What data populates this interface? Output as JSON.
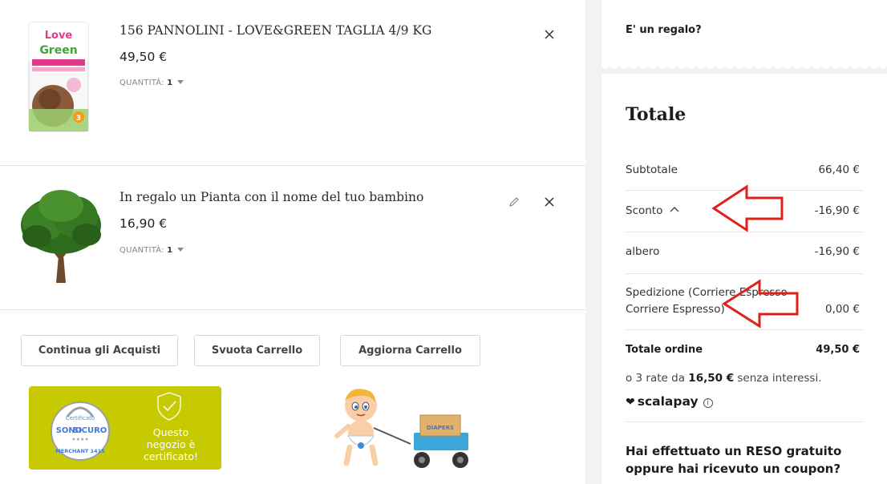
{
  "cart": {
    "items": [
      {
        "title": "156 PANNOLINI - LOVE&GREEN TAGLIA 4/9 KG",
        "price": "49,50 €",
        "qty_label": "QUANTITÀ:",
        "qty_value": "1",
        "image_icon": "diaper-package-image"
      },
      {
        "title": "In regalo un Pianta con il nome del tuo bambino",
        "price": "16,90 €",
        "qty_label": "QUANTITÀ:",
        "qty_value": "1",
        "image_icon": "tree-image"
      }
    ],
    "buttons": {
      "continue": "Continua gli Acquisti",
      "empty": "Svuota Carrello",
      "update": "Aggiorna Carrello"
    },
    "certificate": {
      "text_line1": "Questo",
      "text_line2": "negozio è",
      "text_line3": "certificato!",
      "seal_top": "Certificato",
      "seal_brand_1": "SONO",
      "seal_brand_2": "SICURO",
      "seal_bottom": "MERCHANT 1415",
      "color": "#c7ca00"
    },
    "mascot_label": "DIAPERS"
  },
  "sidebar": {
    "gift_label": "E' un regalo?",
    "totals_title": "Totale",
    "rows": {
      "subtotal_label": "Subtotale",
      "subtotal_value": "66,40 €",
      "discount_label": "Sconto",
      "discount_value": "-16,90 €",
      "tree_label": "albero",
      "tree_value": "-16,90 €",
      "shipping_label": "Spedizione (Corriere Espresso - Corriere Espresso)",
      "shipping_value": "0,00 €",
      "order_total_label": "Totale ordine",
      "order_total_value": "49,50 €"
    },
    "installments": {
      "prefix": "o 3 rate da",
      "amount": "16,50 €",
      "suffix": "senza interessi."
    },
    "scalapay": "scalapay",
    "coupon_question": "Hai effettuato un RESO gratuito oppure hai ricevuto un coupon?"
  },
  "annotation_color": "#e0201b"
}
